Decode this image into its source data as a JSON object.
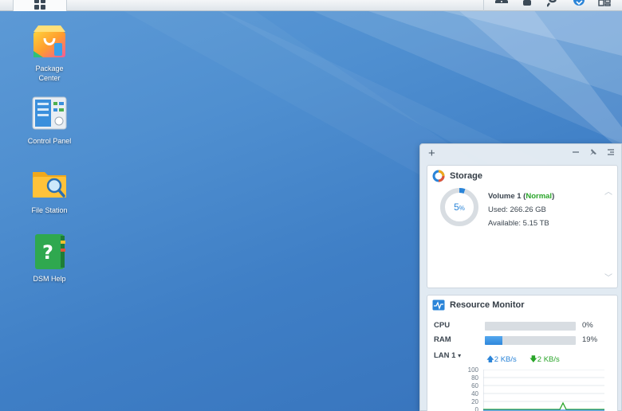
{
  "taskbar": {
    "main_menu_icon": "grid-icon",
    "tray_icons": [
      "chat-icon",
      "user-icon",
      "search-icon",
      "widget-icon",
      "windows-icon"
    ]
  },
  "desktop": {
    "icons": [
      {
        "id": "package-center",
        "label": "Package\nCenter",
        "icon": "shopping-bag-icon"
      },
      {
        "id": "control-panel",
        "label": "Control Panel",
        "icon": "control-panel-icon"
      },
      {
        "id": "file-station",
        "label": "File Station",
        "icon": "folder-search-icon"
      },
      {
        "id": "dsm-help",
        "label": "DSM Help",
        "icon": "help-book-icon"
      }
    ]
  },
  "widgets": {
    "add_label": "+",
    "storage": {
      "title": "Storage",
      "usage_percent": 5,
      "percent_text": "5",
      "percent_unit": "%",
      "volume_name": "Volume 1",
      "status_open": "(",
      "status": "Normal",
      "status_close": ")",
      "used_label": "Used:",
      "used_value": "266.26 GB",
      "available_label": "Available:",
      "available_value": "5.15 TB"
    },
    "resource_monitor": {
      "title": "Resource Monitor",
      "cpu_label": "CPU",
      "cpu_percent": 0,
      "cpu_text": "0%",
      "ram_label": "RAM",
      "ram_percent": 19,
      "ram_text": "19%",
      "lan_label": "LAN 1",
      "lan_caret": "▾",
      "upload": "2 KB/s",
      "download": "2 KB/s",
      "y_ticks": [
        "100",
        "80",
        "60",
        "40",
        "20",
        "0"
      ]
    }
  },
  "colors": {
    "accent": "#2a84d8",
    "status_green": "#2aa52a"
  }
}
